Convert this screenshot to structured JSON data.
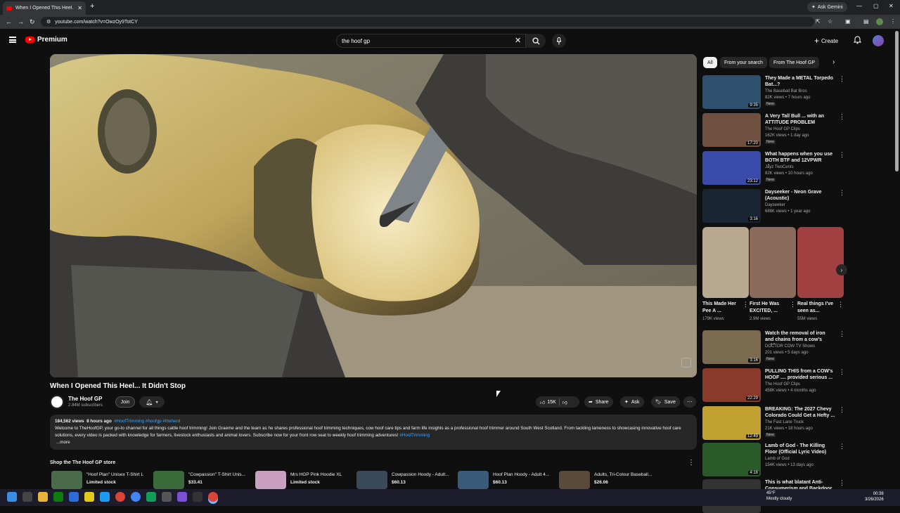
{
  "browser": {
    "tab_title": "When I Opened This Heel... It D",
    "new_tab": "+",
    "ask_gemini": "Ask Gemini",
    "url": "youtube.com/watch?v=OwzOy9TotCY"
  },
  "header": {
    "logo_text": "Premium",
    "search_value": "the hoof gp",
    "create_label": "Create"
  },
  "video": {
    "title": "When I Opened This Heel... It Didn't Stop",
    "channel": "The Hoof GP",
    "subscribers": "2.84M subscribers",
    "join_label": "Join",
    "likes": "15K",
    "share_label": "Share",
    "ask_label": "Ask",
    "save_label": "Save"
  },
  "description": {
    "views": "184,562 views",
    "age": "8 hours ago",
    "hashtags": "#HoofTrimming #hoofgp #theherd",
    "text": "Welcome to TheHoofGP, your go-to channel for all things cattle hoof trimming! Join Graeme and the team as he shares professional hoof trimming techniques, cow hoof care tips and farm life insights as a professional hoof trimmer around South West Scotland. From tackling lameness to showcasing innovative hoof care solutions, every video is packed with knowledge for farmers, livestock enthusiasts and animal lovers. Subscribe now for your front row seat to weekly hoof trimming adventures!",
    "end_tag": "#HoofTrimming",
    "more": "...more"
  },
  "shop": {
    "title": "Shop the The Hoof GP store",
    "items": [
      {
        "name": "\"Hoof Plan\" Unisex T-Shirt L",
        "price": "Limited stock"
      },
      {
        "name": "\"Cowpassion\" T-Shirt Unis...",
        "price": "$33.41"
      },
      {
        "name": "Mrs HGP Pink Hoodie XL",
        "price": "Limited stock"
      },
      {
        "name": "Cowpassion Hoody - Adult...",
        "price": "$60.13"
      },
      {
        "name": "Hoof Plan Hoody - Adult 4...",
        "price": "$60.13"
      },
      {
        "name": "Adults, Tri-Colour Baseball...",
        "price": "$26.06"
      }
    ]
  },
  "chips": [
    "All",
    "From your search",
    "From The Hoof GP"
  ],
  "recommendations": [
    {
      "title": "They Made a METAL Torpedo Bat...?",
      "channel": "The Baseball Bat Bros",
      "meta": "82K views • 7 hours ago",
      "badge": "New",
      "duration": "9:35"
    },
    {
      "title": "A Very Tall Bull ... with an ATTITUDE PROBLEM",
      "channel": "The Hoof GP Clips",
      "meta": "162K views • 1 day ago",
      "badge": "New",
      "duration": "17:20"
    },
    {
      "title": "What happens when you use BOTH BTF and 12VPWR plugs...",
      "channel": "Jayz TwoCents",
      "meta": "82K views • 10 hours ago",
      "badge": "New",
      "duration": "23:12"
    },
    {
      "title": "Dayseeker - Neon Grave (Acoustic)",
      "channel": "Dayseeker",
      "meta": "688K views • 1 year ago",
      "badge": "",
      "duration": "3:16"
    }
  ],
  "shorts": [
    {
      "title": "This Made Her Pee A ...",
      "views": "179K views"
    },
    {
      "title": "First He Was EXCITED, ...",
      "views": "2.9M views"
    },
    {
      "title": "Real things I've seen as...",
      "views": "55M views"
    }
  ],
  "recommendations2": [
    {
      "title": "Watch the removal of iron and chains from a cow's ankle.",
      "channel": "DOCTOR COW TV Shows",
      "meta": "201 views • 5 days ago",
      "badge": "New",
      "duration": "3:16"
    },
    {
      "title": "PULLING THIS from a COW's HOOF .... provided serious ...",
      "channel": "The Hoof GP Clips",
      "meta": "458K views • 4 months ago",
      "badge": "",
      "duration": "22:29"
    },
    {
      "title": "BREAKING: The 2027 Chevy Colorado Could Get a Hefty ...",
      "channel": "The Fast Lane Truck",
      "meta": "21K views • 18 hours ago",
      "badge": "New",
      "duration": "12:49"
    },
    {
      "title": "Lamb of God - The Killing Floor (Official Lyric Video)",
      "channel": "Lamb of God",
      "meta": "154K views • 13 days ago",
      "badge": "",
      "duration": "4:18"
    },
    {
      "title": "This is what blatant Anti-Consumerism and Backdoor ...",
      "channel": "",
      "meta": "",
      "badge": "",
      "duration": ""
    }
  ],
  "taskbar": {
    "temp": "45°F",
    "weather": "Mostly cloudy",
    "time": "00:38",
    "date": "3/26/2026"
  }
}
